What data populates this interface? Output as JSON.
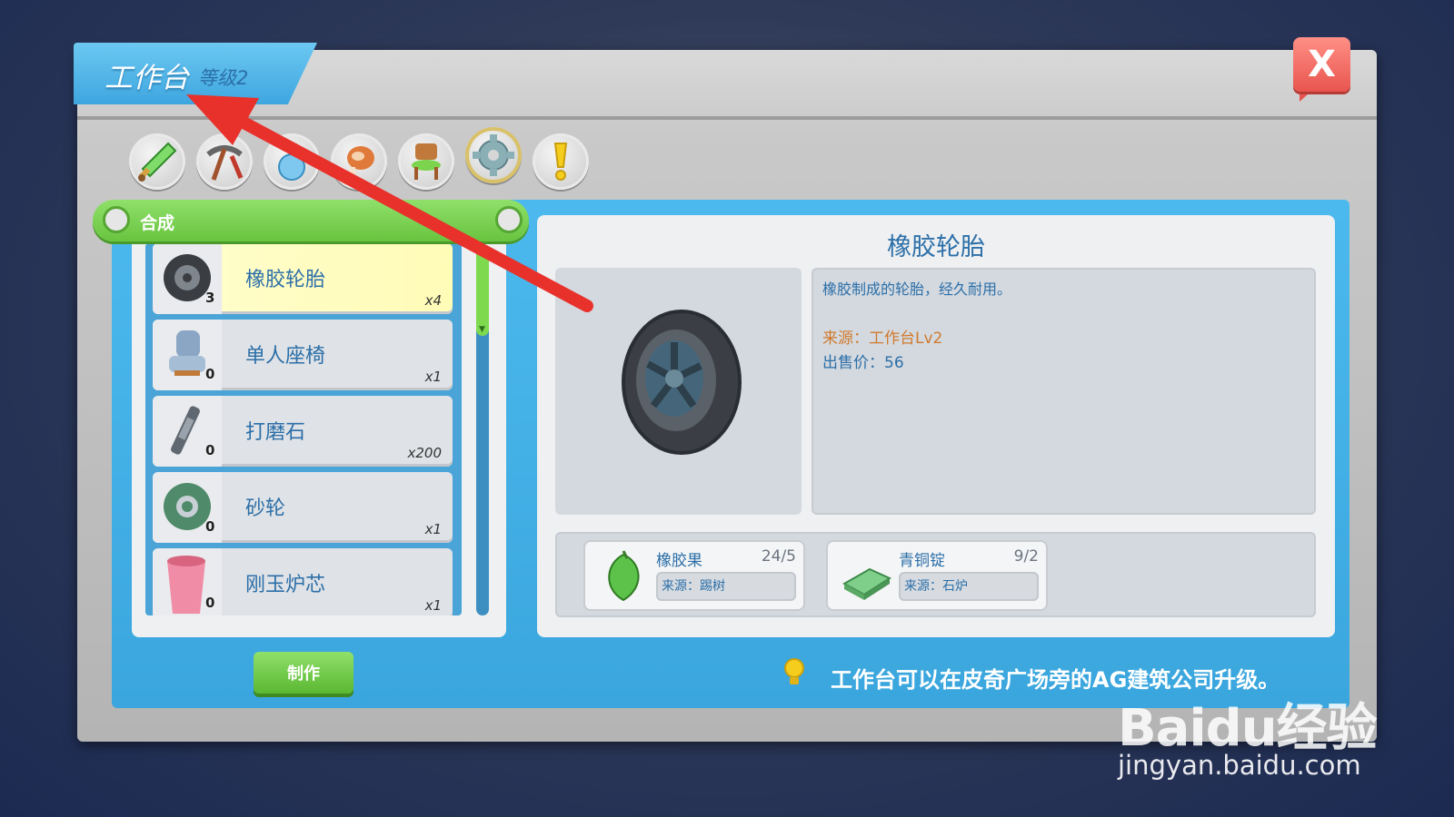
{
  "window": {
    "title": "工作台",
    "level": "等级2",
    "close_label": "X"
  },
  "categories": [
    {
      "name": "sword-icon",
      "selected": false
    },
    {
      "name": "pickaxe-icon",
      "selected": false
    },
    {
      "name": "potion-icon",
      "selected": false
    },
    {
      "name": "food-icon",
      "selected": false
    },
    {
      "name": "chair-icon",
      "selected": false
    },
    {
      "name": "gear-icon",
      "selected": true
    },
    {
      "name": "exclamation-icon",
      "selected": false
    }
  ],
  "recipe_list": {
    "header": "合成",
    "items": [
      {
        "name": "橡胶轮胎",
        "count": "3",
        "qty": "x4",
        "icon": "tire-icon",
        "selected": true
      },
      {
        "name": "单人座椅",
        "count": "0",
        "qty": "x1",
        "icon": "seat-icon",
        "selected": false
      },
      {
        "name": "打磨石",
        "count": "0",
        "qty": "x200",
        "icon": "grindstone-icon",
        "selected": false
      },
      {
        "name": "砂轮",
        "count": "0",
        "qty": "x1",
        "icon": "grinding-wheel-icon",
        "selected": false
      },
      {
        "name": "刚玉炉芯",
        "count": "0",
        "qty": "x1",
        "icon": "furnace-core-icon",
        "selected": false
      }
    ]
  },
  "craft_button": "制作",
  "detail": {
    "title": "橡胶轮胎",
    "description": "橡胶制成的轮胎，经久耐用。",
    "source": "来源：工作台Lv2",
    "price": "出售价：56",
    "materials": [
      {
        "name": "橡胶果",
        "qty": "24/5",
        "source": "来源：踢树",
        "icon": "rubber-fruit-icon"
      },
      {
        "name": "青铜锭",
        "qty": "9/2",
        "source": "来源：石炉",
        "icon": "bronze-ingot-icon"
      }
    ]
  },
  "tip": "工作台可以在皮奇广场旁的AG建筑公司升级。",
  "watermark": {
    "logo": "Baidu经验",
    "url": "jingyan.baidu.com"
  },
  "colors": {
    "accent_blue": "#3ea6df",
    "green": "#69c43f",
    "close_red": "#e8554e",
    "annotation_red": "#e8312b"
  }
}
